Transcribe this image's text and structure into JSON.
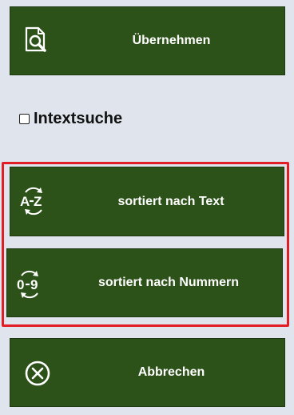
{
  "buttons": {
    "apply_label": "Übernehmen",
    "sort_text_label": "sortiert nach Text",
    "sort_number_label": "sortiert nach Nummern",
    "cancel_label": "Abbrechen"
  },
  "fulltext_search": {
    "label": "Intextsuche",
    "checked": false
  },
  "icons": {
    "apply": "document-search-icon",
    "sort_text": "sort-a-z-icon",
    "sort_number": "sort-0-9-icon",
    "cancel": "circle-x-icon"
  },
  "sort_icon_text": {
    "az_from": "A",
    "az_to": "Z",
    "num_from": "0",
    "num_to": "9"
  },
  "colors": {
    "button_bg": "#2c5219",
    "highlight": "#e11d25",
    "background": "#dfe4ed"
  }
}
